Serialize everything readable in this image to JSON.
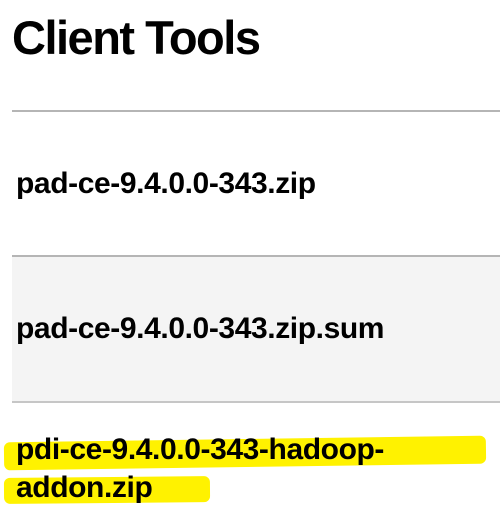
{
  "section": {
    "title": "Client Tools"
  },
  "files": [
    {
      "name": "pad-ce-9.4.0.0-343.zip"
    },
    {
      "name": "pad-ce-9.4.0.0-343.zip.sum"
    },
    {
      "name_line1": "pdi-ce-9.4.0.0-343-hadoop-",
      "name_line2": "addon.zip",
      "highlight_color": "#fff200"
    }
  ]
}
